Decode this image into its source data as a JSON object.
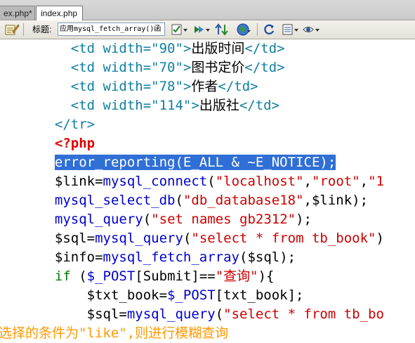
{
  "tabs": [
    {
      "label": "ex.php*"
    },
    {
      "label": "index.php"
    }
  ],
  "toolbar": {
    "title_label": "标题:",
    "title_value": "应用mysql_fetch_array()函"
  },
  "code_lines": [
    {
      "tokens": [
        {
          "t": "    ",
          "c": "t-plain"
        },
        {
          "t": "<td width=",
          "c": "t-tag"
        },
        {
          "t": "\"90\"",
          "c": "t-str"
        },
        {
          "t": ">",
          "c": "t-tag"
        },
        {
          "t": "出版时间",
          "c": "t-text"
        },
        {
          "t": "</td>",
          "c": "t-tag"
        }
      ]
    },
    {
      "tokens": [
        {
          "t": "    ",
          "c": "t-plain"
        },
        {
          "t": "<td width=",
          "c": "t-tag"
        },
        {
          "t": "\"70\"",
          "c": "t-str"
        },
        {
          "t": ">",
          "c": "t-tag"
        },
        {
          "t": "图书定价",
          "c": "t-text"
        },
        {
          "t": "</td>",
          "c": "t-tag"
        }
      ]
    },
    {
      "tokens": [
        {
          "t": "    ",
          "c": "t-plain"
        },
        {
          "t": "<td width=",
          "c": "t-tag"
        },
        {
          "t": "\"78\"",
          "c": "t-str"
        },
        {
          "t": ">",
          "c": "t-tag"
        },
        {
          "t": "作者",
          "c": "t-text"
        },
        {
          "t": "</td>",
          "c": "t-tag"
        }
      ]
    },
    {
      "tokens": [
        {
          "t": "    ",
          "c": "t-plain"
        },
        {
          "t": "<td width=",
          "c": "t-tag"
        },
        {
          "t": "\"114\"",
          "c": "t-str"
        },
        {
          "t": ">",
          "c": "t-tag"
        },
        {
          "t": "出版社",
          "c": "t-text"
        },
        {
          "t": "</td>",
          "c": "t-tag"
        }
      ]
    },
    {
      "tokens": [
        {
          "t": "  ",
          "c": "t-plain"
        },
        {
          "t": "</tr>",
          "c": "t-tag"
        }
      ]
    },
    {
      "tokens": [
        {
          "t": "  ",
          "c": "t-plain"
        },
        {
          "t": "<?php",
          "c": "t-php"
        }
      ]
    },
    {
      "tokens": [
        {
          "t": "  ",
          "c": "t-plain"
        },
        {
          "t": "error_reporting(E_ALL & ~E_NOTICE);",
          "c": "t-sel"
        }
      ]
    },
    {
      "tokens": [
        {
          "t": "  ",
          "c": "t-plain"
        },
        {
          "t": "$link=",
          "c": "t-ident"
        },
        {
          "t": "mysql_connect",
          "c": "t-fn"
        },
        {
          "t": "(",
          "c": "t-plain"
        },
        {
          "t": "\"localhost\"",
          "c": "t-phpstr"
        },
        {
          "t": ",",
          "c": "t-plain"
        },
        {
          "t": "\"root\"",
          "c": "t-phpstr"
        },
        {
          "t": ",",
          "c": "t-plain"
        },
        {
          "t": "\"1",
          "c": "t-phpstr"
        }
      ]
    },
    {
      "tokens": [
        {
          "t": "  ",
          "c": "t-plain"
        },
        {
          "t": "mysql_select_db",
          "c": "t-fn"
        },
        {
          "t": "(",
          "c": "t-plain"
        },
        {
          "t": "\"db_database18\"",
          "c": "t-phpstr"
        },
        {
          "t": ",$link);",
          "c": "t-plain"
        }
      ]
    },
    {
      "tokens": [
        {
          "t": "  ",
          "c": "t-plain"
        },
        {
          "t": "mysql_query",
          "c": "t-fn"
        },
        {
          "t": "(",
          "c": "t-plain"
        },
        {
          "t": "\"set names gb2312\"",
          "c": "t-phpstr"
        },
        {
          "t": ");",
          "c": "t-plain"
        }
      ]
    },
    {
      "tokens": [
        {
          "t": "  ",
          "c": "t-plain"
        },
        {
          "t": "$sql=",
          "c": "t-ident"
        },
        {
          "t": "mysql_query",
          "c": "t-fn"
        },
        {
          "t": "(",
          "c": "t-plain"
        },
        {
          "t": "\"select * from tb_book\"",
          "c": "t-phpstr"
        },
        {
          "t": ")",
          "c": "t-plain"
        }
      ]
    },
    {
      "tokens": [
        {
          "t": "  ",
          "c": "t-plain"
        },
        {
          "t": "$info=",
          "c": "t-ident"
        },
        {
          "t": "mysql_fetch_array",
          "c": "t-fn"
        },
        {
          "t": "($sql);",
          "c": "t-plain"
        }
      ]
    },
    {
      "tokens": [
        {
          "t": "  ",
          "c": "t-plain"
        },
        {
          "t": "if ",
          "c": "t-kw"
        },
        {
          "t": "(",
          "c": "t-plain"
        },
        {
          "t": "$_POST",
          "c": "t-fn"
        },
        {
          "t": "[Submit]==",
          "c": "t-plain"
        },
        {
          "t": "\"查询\"",
          "c": "t-phpstr"
        },
        {
          "t": "){",
          "c": "t-plain"
        }
      ]
    },
    {
      "tokens": [
        {
          "t": "      ",
          "c": "t-plain"
        },
        {
          "t": "$txt_book=",
          "c": "t-ident"
        },
        {
          "t": "$_POST",
          "c": "t-fn"
        },
        {
          "t": "[txt_book];",
          "c": "t-plain"
        }
      ]
    },
    {
      "tokens": [
        {
          "t": "      ",
          "c": "t-plain"
        },
        {
          "t": "$sql=",
          "c": "t-ident"
        },
        {
          "t": "mysql_query",
          "c": "t-fn"
        },
        {
          "t": "(",
          "c": "t-plain"
        },
        {
          "t": "\"select * from tb_bo",
          "c": "t-phpstr"
        }
      ]
    },
    {
      "tokens": [
        {
          "t": "选择的条件为\"like\",则进行模糊查询",
          "c": "t-comment"
        }
      ]
    }
  ]
}
